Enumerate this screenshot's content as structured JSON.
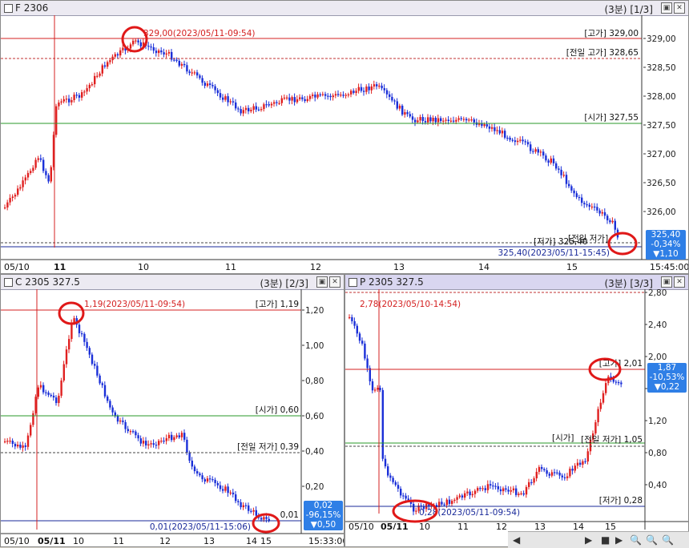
{
  "panes": {
    "f": {
      "title": "F 2306",
      "tag": "(3분)",
      "index": "[1/3]",
      "high_note": "329,00(2023/05/11-09:54)",
      "last_note": "325,40(2023/05/11-15:45)",
      "lines": {
        "high": "[고가] 329,00",
        "prevhigh": "[전일 고가] 328,65",
        "open": "[시가] 327,55",
        "low": "[저가] 325,40",
        "prevlow": "[전일 저가]"
      },
      "yticks": [
        "329,00",
        "328,50",
        "328,00",
        "327,50",
        "327,00",
        "326,50",
        "326,00"
      ],
      "last_box": [
        "325,40",
        "-0,34%",
        "▼1,10"
      ],
      "xticks": [
        "05/10",
        "11",
        "10",
        "11",
        "12",
        "13",
        "14",
        "15",
        "15:45:00"
      ]
    },
    "c": {
      "title": "C 2305 327.5",
      "tag": "(3분)",
      "index": "[2/3]",
      "high_note": "1,19(2023/05/11-09:54)",
      "last_note": "0,01(2023/05/11-15:06)",
      "lines": {
        "high": "[고가] 1,19",
        "open": "[시가] 0,60",
        "prevlow": "[전일 저가] 0,39",
        "low": "0,01"
      },
      "yticks": [
        "1,20",
        "1,00",
        "0,80",
        "0,60",
        "0,40",
        "0,20"
      ],
      "last_box": [
        "0,02",
        "-96,15%",
        "▼0,50"
      ],
      "xticks": [
        "05/10",
        "05/11",
        "10",
        "11",
        "12",
        "13",
        "14",
        "15",
        "15:33:00"
      ]
    },
    "p": {
      "title": "P 2305 327.5",
      "tag": "(3분)",
      "index": "[3/3]",
      "high_note": "2,78(2023/05/10-14:54)",
      "low_note": "0,28(2023/05/11-09:54)",
      "lines": {
        "high": "[고가] 2,01",
        "open": "[시가]",
        "prevlow": "[전일 저가] 1,05",
        "low": "[저가] 0,28"
      },
      "yticks": [
        "2,80",
        "2,40",
        "2,00",
        "1,60",
        "1,20",
        "0,80",
        "0,40"
      ],
      "last_box": [
        "1,87",
        "-10,53%",
        "▼0,22"
      ],
      "xticks": [
        "05/10",
        "05/11",
        "10",
        "11",
        "12",
        "13",
        "14",
        "15"
      ]
    }
  },
  "footer_time": "15:33:00",
  "colors": {
    "up": "#e02020",
    "down": "#1a2fd8",
    "high_line": "#d42020",
    "open_line": "#2a9a2a",
    "low_line": "#1a2a9a",
    "accent": "#2f7fe6"
  }
}
